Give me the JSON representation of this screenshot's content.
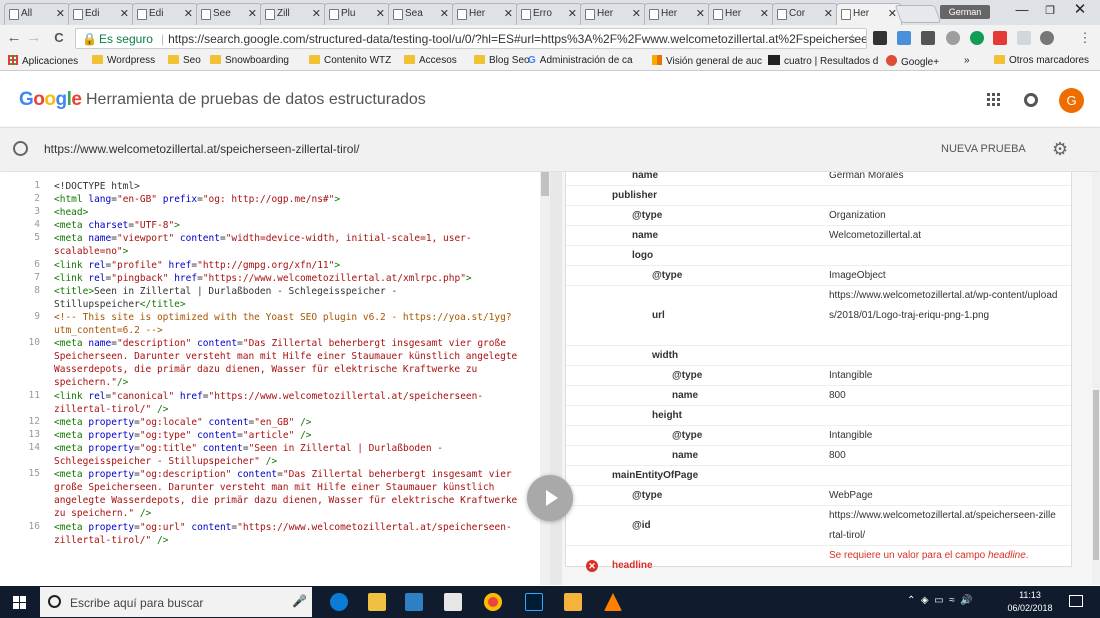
{
  "browser": {
    "tabs": [
      {
        "label": "All"
      },
      {
        "label": "Edi"
      },
      {
        "label": "Edi"
      },
      {
        "label": "See"
      },
      {
        "label": "Zill"
      },
      {
        "label": "Plu"
      },
      {
        "label": "Sea"
      },
      {
        "label": "Her"
      },
      {
        "label": "Erro"
      },
      {
        "label": "Her"
      },
      {
        "label": "Her"
      },
      {
        "label": "Her"
      },
      {
        "label": "Cor"
      },
      {
        "label": "Her"
      }
    ],
    "profile": "German",
    "nav": {
      "back": "←",
      "forward": "→",
      "reload": "C"
    },
    "url": {
      "secure_label": "Es seguro",
      "address": "https://search.google.com/structured-data/testing-tool/u/0/?hl=ES#url=https%3A%2F%2Fwww.welcometozillertal.at%2Fspeicherseen-..."
    },
    "bookmarks": [
      {
        "label": "Aplicaciones",
        "icon": "apps-icon"
      },
      {
        "label": "Wordpress",
        "icon": "folder-icon"
      },
      {
        "label": "Seo",
        "icon": "folder-icon"
      },
      {
        "label": "Snowboarding",
        "icon": "folder-icon"
      },
      {
        "label": "Contenito WTZ",
        "icon": "folder-icon"
      },
      {
        "label": "Accesos",
        "icon": "folder-icon"
      },
      {
        "label": "Blog Seo",
        "icon": "folder-icon"
      },
      {
        "label": "Administración de ca",
        "icon": "google-icon"
      },
      {
        "label": "Visión general de auc",
        "icon": "analytics-icon"
      },
      {
        "label": "cuatro | Resultados d",
        "icon": "tv-icon"
      },
      {
        "label": "Google+",
        "icon": "gplus-icon"
      }
    ],
    "bookmarks_more": "»",
    "other_bookmarks": "Otros marcadores"
  },
  "app": {
    "logo_letters": [
      {
        "ch": "G",
        "color": "#4285f4"
      },
      {
        "ch": "o",
        "color": "#ea4335"
      },
      {
        "ch": "o",
        "color": "#fbbc05"
      },
      {
        "ch": "g",
        "color": "#4285f4"
      },
      {
        "ch": "l",
        "color": "#34a853"
      },
      {
        "ch": "e",
        "color": "#ea4335"
      }
    ],
    "title": "Herramienta de pruebas de datos estructurados",
    "avatar_letter": "G",
    "avatar_color": "#ef6c00",
    "tested_url": "https://www.welcometozillertal.at/speicherseen-zillertal-tirol/",
    "new_test_label": "NUEVA PRUEBA"
  },
  "code_lines": [
    {
      "n": "1",
      "html": "&lt;!DOCTYPE html&gt;"
    },
    {
      "n": "2",
      "html": "<span class='tag'>&lt;html</span> <span class='attr'>lang</span>=<span class='str'>\"en-GB\"</span> <span class='attr'>prefix</span>=<span class='str'>\"og: http://ogp.me/ns#\"</span><span class='tag'>&gt;</span>"
    },
    {
      "n": "3",
      "html": "<span class='tag'>&lt;head&gt;</span>"
    },
    {
      "n": "4",
      "html": "<span class='tag'>&lt;meta</span> <span class='attr'>charset</span>=<span class='str'>\"UTF-8\"</span><span class='tag'>&gt;</span>"
    },
    {
      "n": "5",
      "html": "<span class='tag'>&lt;meta</span> <span class='attr'>name</span>=<span class='str'>\"viewport\"</span> <span class='attr'>content</span>=<span class='str'>\"width=device-width, initial-scale=1, user-<br>scalable=no\"</span><span class='tag'>&gt;</span>"
    },
    {
      "n": "6",
      "html": "<span class='tag'>&lt;link</span> <span class='attr'>rel</span>=<span class='str'>\"profile\"</span> <span class='attr'>href</span>=<span class='str'>\"http://gmpg.org/xfn/11\"</span><span class='tag'>&gt;</span>"
    },
    {
      "n": "7",
      "html": "<span class='tag'>&lt;link</span> <span class='attr'>rel</span>=<span class='str'>\"pingback\"</span> <span class='attr'>href</span>=<span class='str'>\"https://www.welcometozillertal.at/xmlrpc.php\"</span><span class='tag'>&gt;</span>"
    },
    {
      "n": "8",
      "html": "<span class='tag'>&lt;title&gt;</span>Seen in Zillertal | Durlaßboden - Schlegeisspeicher -<br>Stillupspeicher<span class='tag'>&lt;/title&gt;</span>"
    },
    {
      "n": "9",
      "html": "<span class='cmt'>&lt;!-- This site is optimized with the Yoast SEO plugin v6.2 - https://yoa.st/1yg?<br>utm_content=6.2 --&gt;</span>"
    },
    {
      "n": "10",
      "html": "<span class='tag'>&lt;meta</span> <span class='attr'>name</span>=<span class='str'>\"description\"</span> <span class='attr'>content</span>=<span class='str'>\"Das Zillertal beherbergt insgesamt vier große<br>Speicherseen. Darunter versteht man mit Hilfe einer Staumauer künstlich angelegte<br>Wasserdepots, die primär dazu dienen, Wasser für elektrische Kraftwerke zu<br>speichern.\"</span><span class='tag'>/&gt;</span>"
    },
    {
      "n": "11",
      "html": "<span class='tag'>&lt;link</span> <span class='attr'>rel</span>=<span class='str'>\"canonical\"</span> <span class='attr'>href</span>=<span class='str'>\"https://www.welcometozillertal.at/speicherseen-<br>zillertal-tirol/\"</span> <span class='tag'>/&gt;</span>"
    },
    {
      "n": "12",
      "html": "<span class='tag'>&lt;meta</span> <span class='attr'>property</span>=<span class='str'>\"og:locale\"</span> <span class='attr'>content</span>=<span class='str'>\"en_GB\"</span> <span class='tag'>/&gt;</span>"
    },
    {
      "n": "13",
      "html": "<span class='tag'>&lt;meta</span> <span class='attr'>property</span>=<span class='str'>\"og:type\"</span> <span class='attr'>content</span>=<span class='str'>\"article\"</span> <span class='tag'>/&gt;</span>"
    },
    {
      "n": "14",
      "html": "<span class='tag'>&lt;meta</span> <span class='attr'>property</span>=<span class='str'>\"og:title\"</span> <span class='attr'>content</span>=<span class='str'>\"Seen in Zillertal | Durlaßboden -<br>Schlegeisspeicher - Stillupspeicher\"</span> <span class='tag'>/&gt;</span>"
    },
    {
      "n": "15",
      "html": "<span class='tag'>&lt;meta</span> <span class='attr'>property</span>=<span class='str'>\"og:description\"</span> <span class='attr'>content</span>=<span class='str'>\"Das Zillertal beherbergt insgesamt vier<br>große Speicherseen. Darunter versteht man mit Hilfe einer Staumauer künstlich<br>angelegte Wasserdepots, die primär dazu dienen, Wasser für elektrische Kraftwerke<br>zu speichern.\"</span> <span class='tag'>/&gt;</span>"
    },
    {
      "n": "16",
      "html": "<span class='tag'>&lt;meta</span> <span class='attr'>property</span>=<span class='str'>\"og:url\"</span> <span class='attr'>content</span>=<span class='str'>\"https://www.welcometozillertal.at/speicherseen-<br>zillertal-tirol/\"</span> <span class='tag'>/&gt;</span>"
    }
  ],
  "result_rows": [
    {
      "key": "name",
      "value": "German Morales",
      "indent": 2
    },
    {
      "key": "publisher",
      "value": "",
      "indent": 1
    },
    {
      "key": "@type",
      "value": "Organization",
      "indent": 2
    },
    {
      "key": "name",
      "value": "Welcometozillertal.at",
      "indent": 2
    },
    {
      "key": "logo",
      "value": "",
      "indent": 2
    },
    {
      "key": "@type",
      "value": "ImageObject",
      "indent": 3
    },
    {
      "key": "url",
      "value": "https://www.welcometozillertal.at/wp-content/uploads/2018/01/Logo-traj-eriqu-png-1.png",
      "indent": 3
    },
    {
      "key": "width",
      "value": "",
      "indent": 3
    },
    {
      "key": "@type",
      "value": "Intangible",
      "indent": 4
    },
    {
      "key": "name",
      "value": "800",
      "indent": 4
    },
    {
      "key": "height",
      "value": "",
      "indent": 3
    },
    {
      "key": "@type",
      "value": "Intangible",
      "indent": 4
    },
    {
      "key": "name",
      "value": "800",
      "indent": 4
    },
    {
      "key": "mainEntityOfPage",
      "value": "",
      "indent": 1
    },
    {
      "key": "@type",
      "value": "WebPage",
      "indent": 2
    },
    {
      "key": "@id",
      "value": "https://www.welcometozillertal.at/speicherseen-zillertal-tirol/",
      "indent": 2
    },
    {
      "key": "headline",
      "value": "Se requiere un valor para el campo headline.",
      "indent": 1,
      "error": true
    }
  ],
  "taskbar": {
    "search_placeholder": "Escribe aquí para buscar",
    "time": "11:13",
    "date": "06/02/2018"
  }
}
